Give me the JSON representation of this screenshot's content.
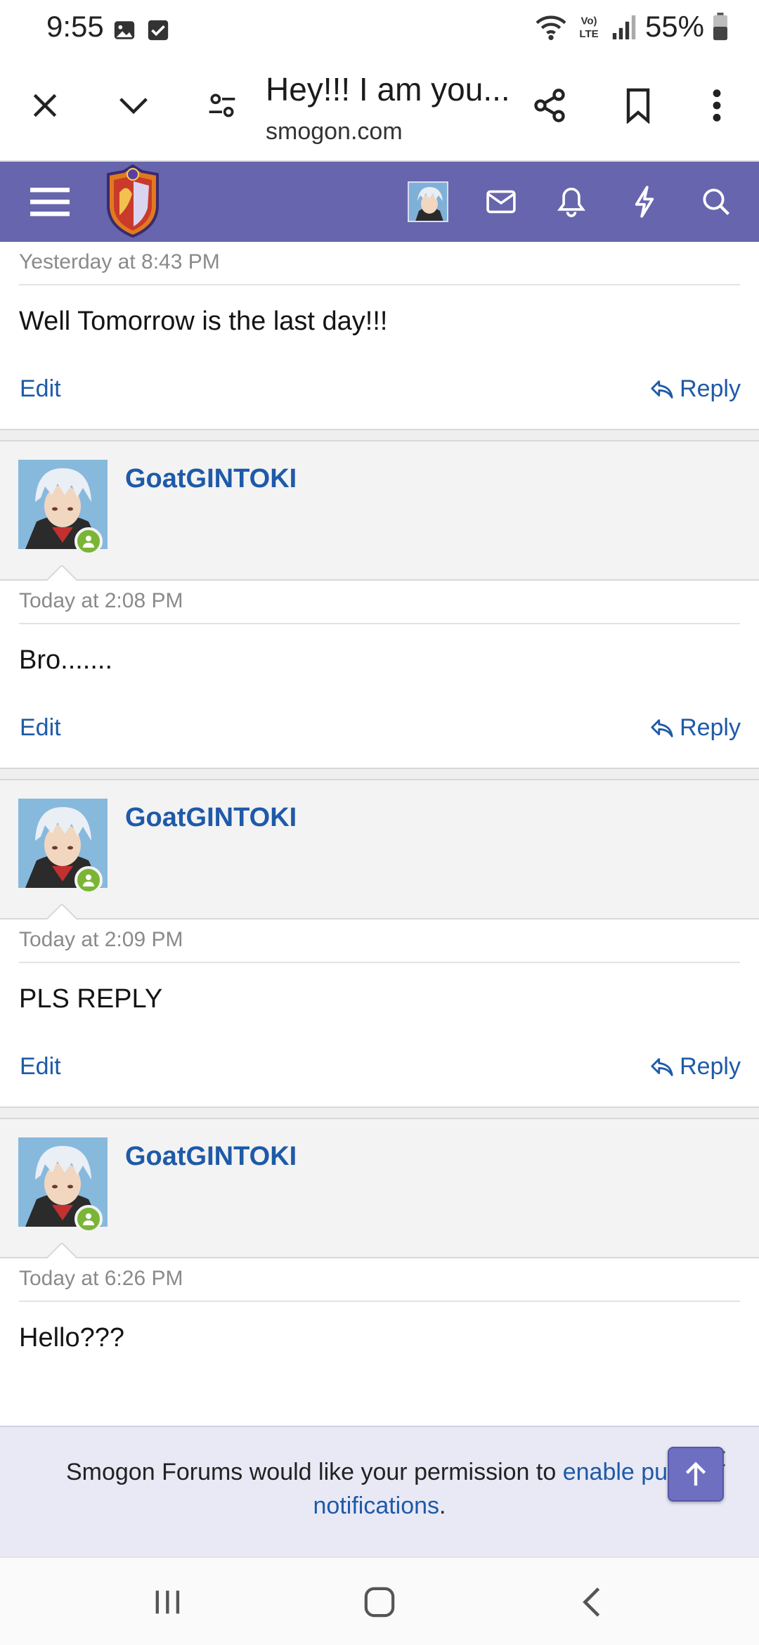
{
  "status_bar": {
    "time": "9:55",
    "battery": "55%",
    "icons": [
      "image-icon",
      "check-box-icon",
      "wifi-icon",
      "volte-icon",
      "signal-icon",
      "battery-icon"
    ]
  },
  "browser": {
    "title": "Hey!!! I am you...",
    "url": "smogon.com",
    "icons": [
      "close-icon",
      "chevron-down-icon",
      "site-settings-icon",
      "share-icon",
      "bookmark-icon",
      "more-vert-icon"
    ]
  },
  "site_header": {
    "icons": [
      "menu-icon",
      "smogon-logo",
      "user-avatar",
      "mail-icon",
      "bell-icon",
      "lightning-icon",
      "search-icon"
    ],
    "colors": {
      "header_bg": "#6665ad",
      "link": "#1e5aa8",
      "online": "#7bb536"
    }
  },
  "messages": [
    {
      "date": "Yesterday at 8:43 PM",
      "text": "Well Tomorrow is the last day!!!",
      "edit": "Edit",
      "reply": "Reply"
    },
    {
      "user": "GoatGINTOKI",
      "date": "Today at 2:08 PM",
      "text": "Bro.......",
      "edit": "Edit",
      "reply": "Reply"
    },
    {
      "user": "GoatGINTOKI",
      "date": "Today at 2:09 PM",
      "text": "PLS REPLY",
      "edit": "Edit",
      "reply": "Reply"
    },
    {
      "user": "GoatGINTOKI",
      "date": "Today at 6:26 PM",
      "text": "Hello???"
    }
  ],
  "push_banner": {
    "text_before": "Smogon Forums would like your permission to ",
    "link_text": "enable push notifications",
    "text_after": "."
  }
}
